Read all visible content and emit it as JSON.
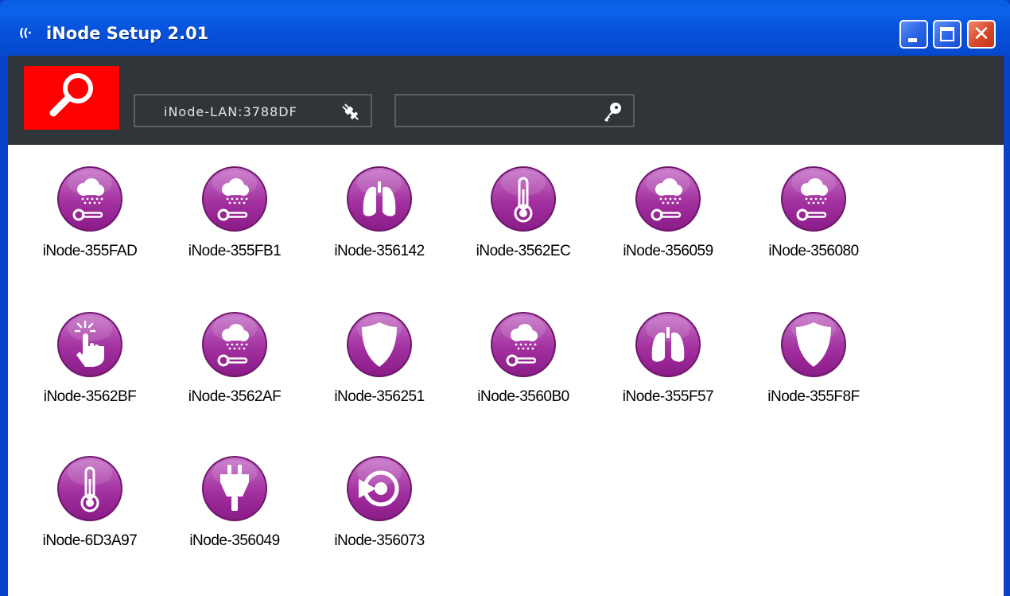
{
  "window": {
    "title": "iNode Setup 2.01",
    "app_icon": "((·",
    "close_glyph": "✕"
  },
  "toolbar": {
    "search_button": "search-icon",
    "connection": {
      "label": "iNode-LAN:3788DF",
      "icon": "plug-icon"
    },
    "password": {
      "value": "",
      "icon": "key-icon"
    }
  },
  "colors": {
    "accent": "#ff0000",
    "toolbar": "#2f3538",
    "icon_purple": "#a03aa6",
    "titlebar": "#0652db"
  },
  "nodes": [
    {
      "name": "iNode-355FAD",
      "icon": "weather-icon"
    },
    {
      "name": "iNode-355FB1",
      "icon": "weather-icon"
    },
    {
      "name": "iNode-356142",
      "icon": "lungs-icon"
    },
    {
      "name": "iNode-3562EC",
      "icon": "thermometer-icon"
    },
    {
      "name": "iNode-356059",
      "icon": "weather-icon"
    },
    {
      "name": "iNode-356080",
      "icon": "weather-icon"
    },
    {
      "name": "iNode-3562BF",
      "icon": "touch-icon"
    },
    {
      "name": "iNode-3562AF",
      "icon": "weather-icon"
    },
    {
      "name": "iNode-356251",
      "icon": "shield-icon"
    },
    {
      "name": "iNode-3560B0",
      "icon": "weather-icon"
    },
    {
      "name": "iNode-355F57",
      "icon": "lungs-icon"
    },
    {
      "name": "iNode-355F8F",
      "icon": "shield-icon"
    },
    {
      "name": "iNode-6D3A97",
      "icon": "thermometer-icon"
    },
    {
      "name": "iNode-356049",
      "icon": "plug-icon"
    },
    {
      "name": "iNode-356073",
      "icon": "target-icon"
    }
  ]
}
